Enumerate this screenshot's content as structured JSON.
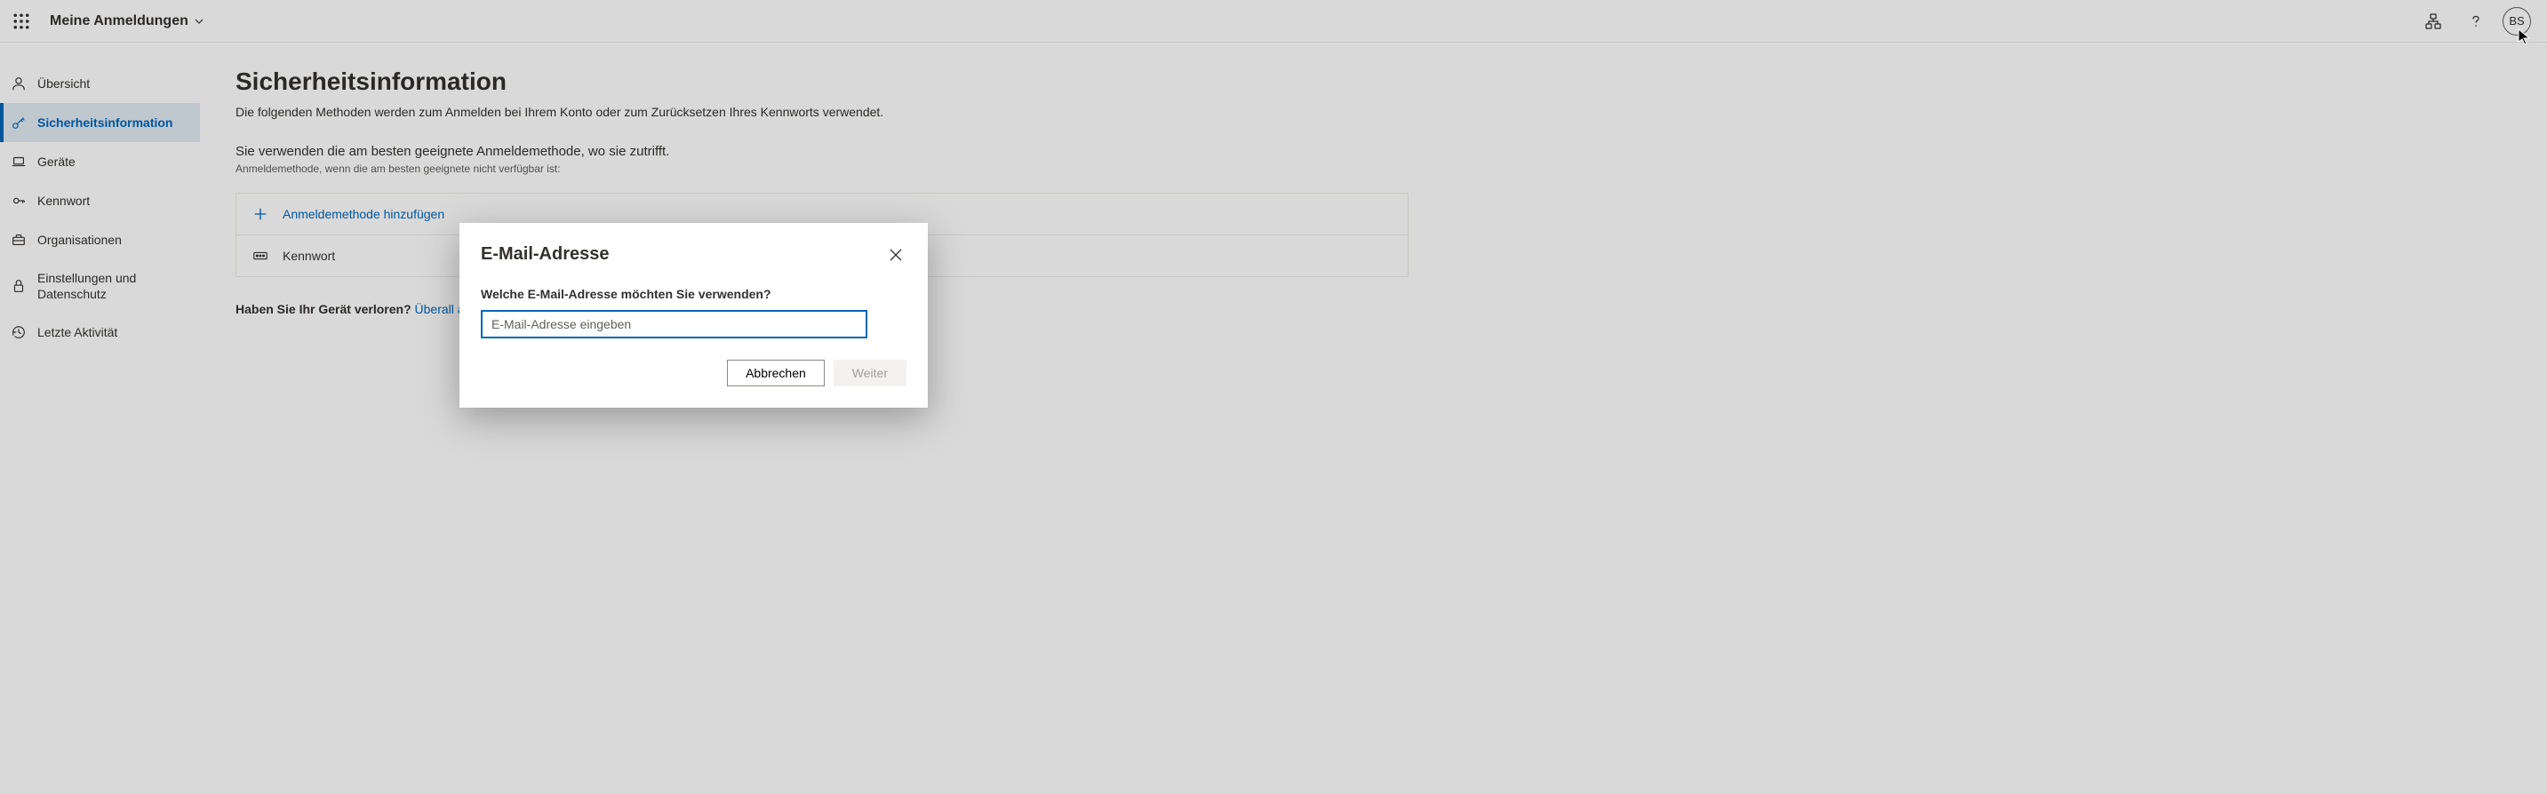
{
  "header": {
    "title": "Meine Anmeldungen",
    "avatar_initials": "BS"
  },
  "sidebar": {
    "items": [
      {
        "label": "Übersicht"
      },
      {
        "label": "Sicherheitsinformation"
      },
      {
        "label": "Geräte"
      },
      {
        "label": "Kennwort"
      },
      {
        "label": "Organisationen"
      },
      {
        "label": "Einstellungen und Datenschutz"
      },
      {
        "label": "Letzte Aktivität"
      }
    ]
  },
  "main": {
    "title": "Sicherheitsinformation",
    "subtitle": "Die folgenden Methoden werden zum Anmelden bei Ihrem Konto oder zum Zurücksetzen Ihres Kennworts verwendet.",
    "method_heading": "Sie verwenden die am besten geeignete Anmeldemethode, wo sie zutrifft.",
    "method_sub": "Anmeldemethode, wenn die am besten geeignete nicht verfügbar ist:",
    "add_method": "Anmeldemethode hinzufügen",
    "methods": [
      {
        "label": "Kennwort"
      }
    ],
    "lost_device_q": "Haben Sie Ihr Gerät verloren?",
    "lost_device_link": "Überall a"
  },
  "dialog": {
    "title": "E-Mail-Adresse",
    "label": "Welche E-Mail-Adresse möchten Sie verwenden?",
    "placeholder": "E-Mail-Adresse eingeben",
    "cancel": "Abbrechen",
    "next": "Weiter"
  }
}
